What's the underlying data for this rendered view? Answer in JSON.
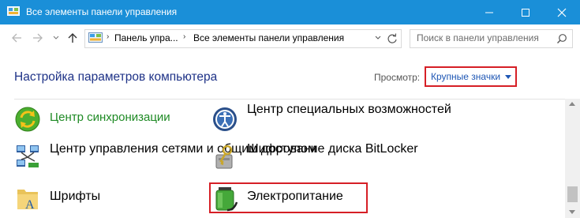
{
  "window": {
    "title": "Все элементы панели управления",
    "controls": {
      "minimize": "minimize-icon",
      "maximize": "maximize-icon",
      "close": "close-icon"
    }
  },
  "navigation": {
    "back": "back-arrow-icon",
    "forward": "forward-arrow-icon",
    "recent": "chevron-down-icon",
    "up": "up-arrow-icon",
    "breadcrumbs": [
      "Панель упра...",
      "Все элементы панели управления"
    ],
    "search_placeholder": "Поиск в панели управления"
  },
  "header": {
    "title": "Настройка параметров компьютера",
    "view_by_label": "Просмотр:",
    "view_by_value": "Крупные значки"
  },
  "items": [
    {
      "label": "Центр синхронизации",
      "icon": "sync-center-icon"
    },
    {
      "label": "Центр специальных\nвозможностей",
      "icon": "ease-of-access-icon"
    },
    {
      "label": "Центр управления сетями\nи общим доступом",
      "icon": "network-sharing-icon"
    },
    {
      "label": "Шифрование диска\nBitLocker",
      "icon": "bitlocker-icon"
    },
    {
      "label": "Шрифты",
      "icon": "fonts-icon"
    },
    {
      "label": "Электропитание",
      "icon": "power-options-icon"
    }
  ],
  "colors": {
    "titlebar": "#1a8fd8",
    "heading": "#1e3287",
    "item_link": "#1e8a24",
    "highlight": "#d61f26"
  }
}
